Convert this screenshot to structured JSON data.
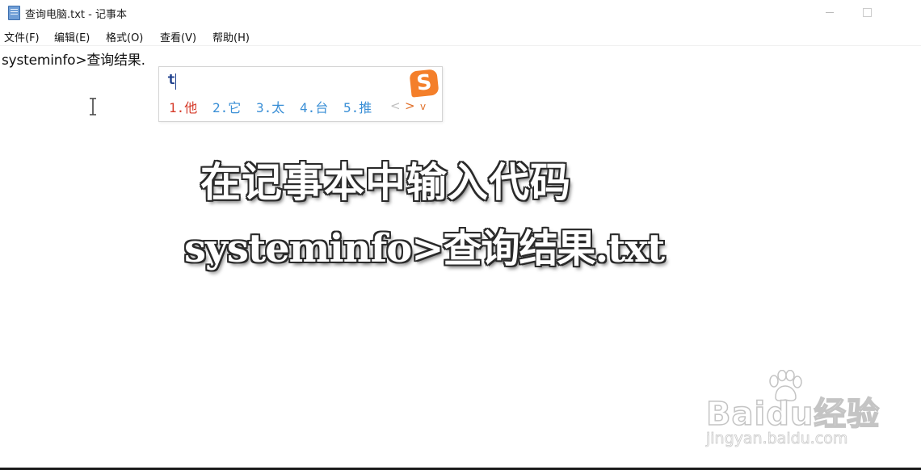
{
  "window": {
    "title": "查询电脑.txt - 记事本"
  },
  "menu": {
    "file": "文件(F)",
    "edit": "编辑(E)",
    "format": "格式(O)",
    "view": "查看(V)",
    "help": "帮助(H)"
  },
  "editor": {
    "content": "systeminfo>查询结果."
  },
  "ime": {
    "input": "t",
    "candidates": [
      "1.他",
      "2.它",
      "3.太",
      "4.台",
      "5.推"
    ],
    "logo": "S",
    "prev": "<",
    "next": ">",
    "more": "v"
  },
  "caption": {
    "line1": "在记事本中输入代码",
    "line2": "systeminfo>查询结果.txt"
  },
  "watermark": {
    "brand": "Baidu经验",
    "url": "jingyan.baidu.com"
  },
  "colors": {
    "ime_first_candidate": "#d63b2a",
    "ime_candidate": "#3a8fd6",
    "ime_logo": "#f47f2a"
  }
}
